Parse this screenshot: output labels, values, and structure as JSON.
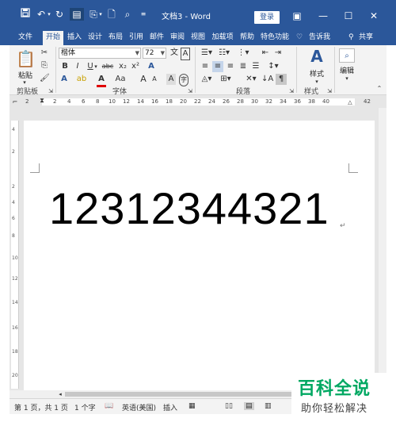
{
  "titlebar": {
    "title": "文档3  -  Word",
    "login_label": "登录",
    "icons": [
      "save-icon",
      "undo-icon",
      "redo-icon",
      "read-mode-icon",
      "paste-special-icon",
      "new-doc-icon",
      "print-preview-icon",
      "customize-icon"
    ]
  },
  "tabs": [
    "文件",
    "开始",
    "插入",
    "设计",
    "布局",
    "引用",
    "邮件",
    "审阅",
    "视图",
    "加载项",
    "帮助",
    "特色功能"
  ],
  "tell_me": "告诉我",
  "share": "共享",
  "ribbon": {
    "clipboard": {
      "paste_label": "粘贴",
      "group_label": "剪贴板"
    },
    "font": {
      "font_name": "楷体",
      "font_size": "72",
      "bold": "B",
      "italic": "I",
      "underline": "U",
      "strikethrough": "abc",
      "subscript": "x₂",
      "superscript": "x²",
      "font_color_a": "A",
      "case_label": "Aa",
      "grow": "A",
      "shrink": "A",
      "wen": "文",
      "clear": "A",
      "group_label": "字体"
    },
    "paragraph": {
      "group_label": "段落"
    },
    "styles": {
      "label": "样式",
      "group_label": "样式"
    },
    "editing": {
      "label": "编辑"
    }
  },
  "ruler": {
    "ticks": [
      "2",
      "2",
      "4",
      "6",
      "8",
      "10",
      "12",
      "14",
      "16",
      "18",
      "20",
      "22",
      "24",
      "26",
      "28",
      "30",
      "32",
      "34",
      "36",
      "38",
      "40",
      "42"
    ]
  },
  "vruler": {
    "ticks": [
      "4",
      "2",
      "2",
      "4",
      "6",
      "8",
      "10",
      "12",
      "14",
      "16",
      "18",
      "20"
    ]
  },
  "document": {
    "text": "12312344321",
    "para_mark": "↵"
  },
  "statusbar": {
    "page": "第 1 页，共 1 页",
    "words": "1 个字",
    "language": "英语(美国)",
    "mode": "插入"
  },
  "watermark": {
    "title": "百科全说",
    "subtitle": "助你轻松解决"
  },
  "colors": {
    "accent": "#2b579a",
    "ribbon_bg": "#f3f3f3",
    "watermark_green": "#00a862"
  }
}
